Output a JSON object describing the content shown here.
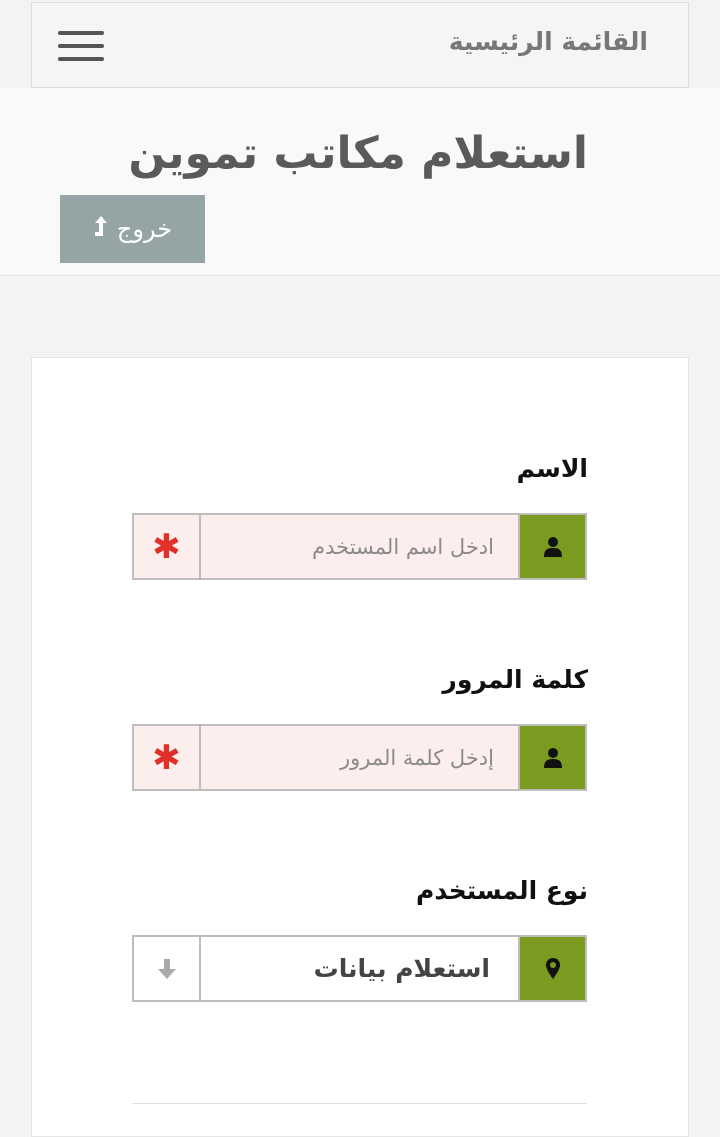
{
  "nav": {
    "home_label": "القائمة الرئيسية",
    "menu_icon": "hamburger-menu-icon"
  },
  "header": {
    "title": "استعلام مكاتب تموين",
    "logout_label": "خروج",
    "logout_icon": "arrow-up-icon"
  },
  "form": {
    "username": {
      "label": "الاسم",
      "placeholder": "ادخل اسم المستخدم",
      "value": "",
      "icon": "user-icon",
      "required_icon": "asterisk-icon"
    },
    "password": {
      "label": "كلمة المرور",
      "placeholder": "إدخل كلمة المرور",
      "value": "",
      "icon": "user-icon",
      "required_icon": "asterisk-icon"
    },
    "user_type": {
      "label": "نوع المستخدم",
      "selected": "استعلام بيانات",
      "icon": "map-marker-icon",
      "dropdown_icon": "arrow-down-icon"
    }
  },
  "colors": {
    "accent_green": "#7a9b20",
    "logout_gray": "#95a5a6",
    "required_red": "#e0302a",
    "input_bg": "#fdeeee"
  }
}
